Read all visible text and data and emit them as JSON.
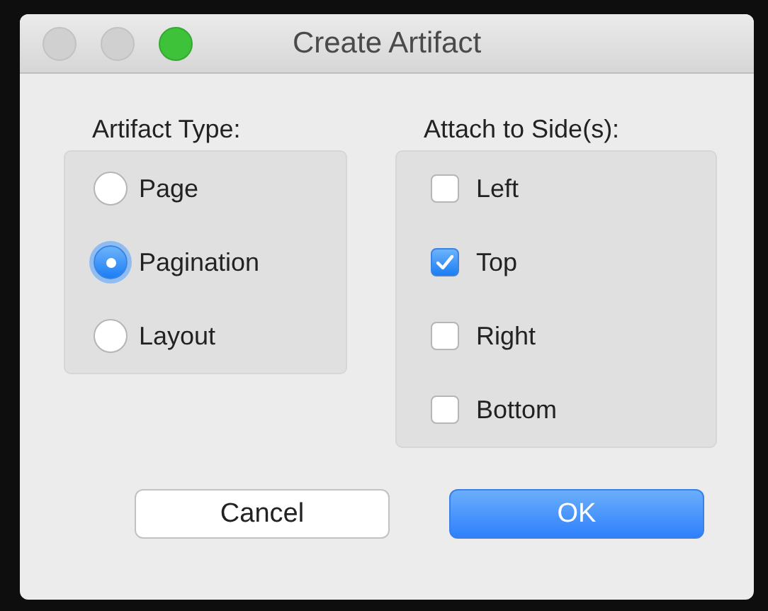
{
  "window": {
    "title": "Create Artifact"
  },
  "artifact_type": {
    "label": "Artifact Type:",
    "options": [
      {
        "label": "Page",
        "selected": false
      },
      {
        "label": "Pagination",
        "selected": true
      },
      {
        "label": "Layout",
        "selected": false
      }
    ]
  },
  "attach_to_sides": {
    "label": "Attach to Side(s):",
    "options": [
      {
        "label": "Left",
        "checked": false
      },
      {
        "label": "Top",
        "checked": true
      },
      {
        "label": "Right",
        "checked": false
      },
      {
        "label": "Bottom",
        "checked": false
      }
    ]
  },
  "buttons": [
    {
      "label": "Cancel",
      "default": false
    },
    {
      "label": "OK",
      "default": true
    }
  ]
}
